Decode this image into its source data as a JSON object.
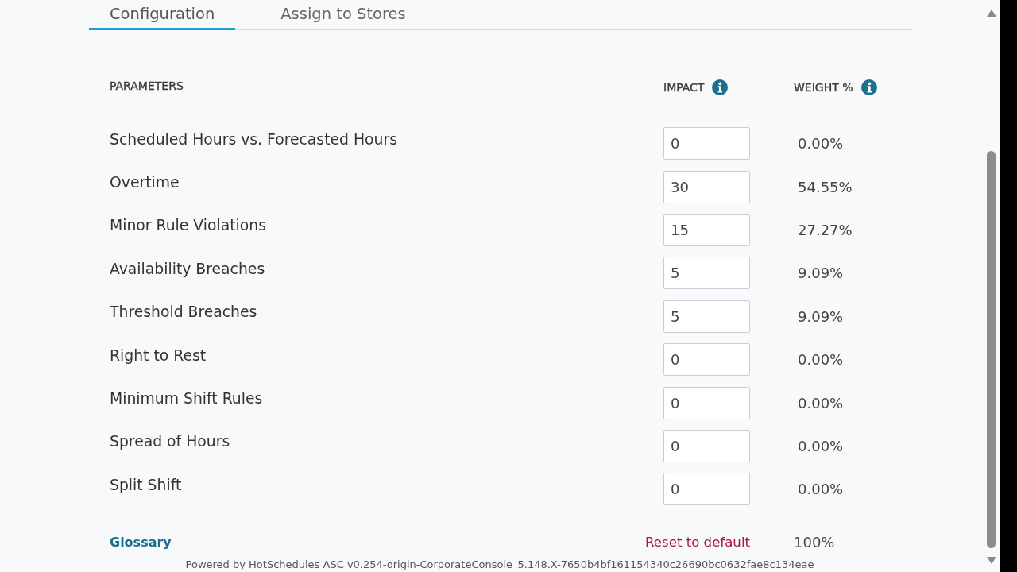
{
  "tabs": [
    {
      "label": "Configuration",
      "selected": true
    },
    {
      "label": "Assign to Stores",
      "selected": false
    }
  ],
  "table": {
    "columns": [
      {
        "label": "PARAMETERS",
        "info": false
      },
      {
        "label": "IMPACT",
        "info": true
      },
      {
        "label": "WEIGHT %",
        "info": true
      }
    ],
    "rows": [
      {
        "parameter": "Scheduled Hours vs. Forecasted Hours",
        "impact": "0",
        "weight": "0.00%"
      },
      {
        "parameter": "Overtime",
        "impact": "30",
        "weight": "54.55%"
      },
      {
        "parameter": "Minor Rule Violations",
        "impact": "15",
        "weight": "27.27%"
      },
      {
        "parameter": "Availability Breaches",
        "impact": "5",
        "weight": "9.09%"
      },
      {
        "parameter": "Threshold Breaches",
        "impact": "5",
        "weight": "9.09%"
      },
      {
        "parameter": "Right to Rest",
        "impact": "0",
        "weight": "0.00%"
      },
      {
        "parameter": "Minimum Shift Rules",
        "impact": "0",
        "weight": "0.00%"
      },
      {
        "parameter": "Spread of Hours",
        "impact": "0",
        "weight": "0.00%"
      },
      {
        "parameter": "Split Shift",
        "impact": "0",
        "weight": "0.00%"
      }
    ]
  },
  "summary": {
    "glossary_link": "Glossary",
    "reset_link": "Reset to default",
    "total_weight": "100%"
  },
  "footer": "Powered by HotSchedules ASC v0.254-origin-CorporateConsole_5.148.X-7650b4bf161154340c26690bc0632fae8c134eae"
}
